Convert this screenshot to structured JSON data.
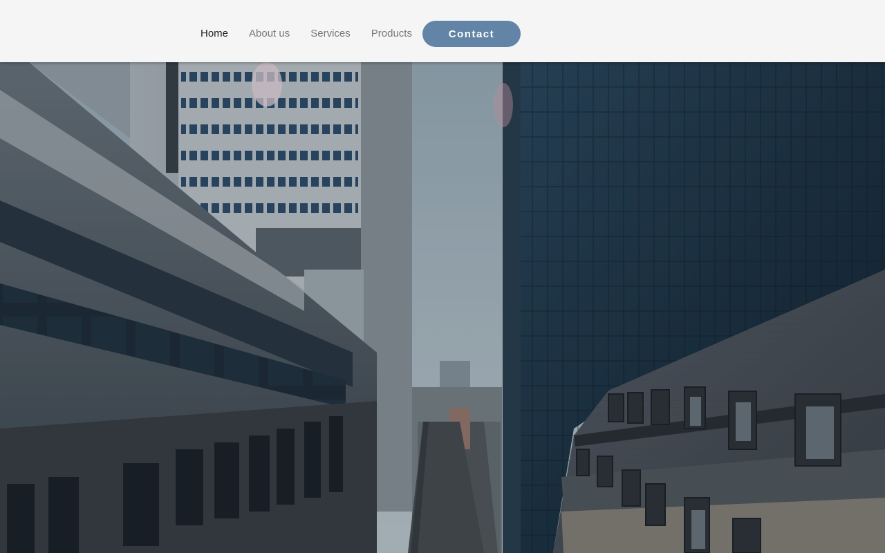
{
  "nav": {
    "items": [
      {
        "label": "Home",
        "active": true
      },
      {
        "label": "About us",
        "active": false
      },
      {
        "label": "Services",
        "active": false
      },
      {
        "label": "Products",
        "active": false
      }
    ],
    "contact_label": "Contact"
  },
  "colors": {
    "header_bg": "#f5f5f5",
    "nav_text": "#777777",
    "nav_active": "#1f1f1f",
    "contact_bg": "#6285a7",
    "sky": "#aebfc8",
    "glass_tower": "#22384a",
    "office_facade": "#5b6670",
    "old_roof": "#4b5158"
  },
  "hero": {
    "icon": "city-skyline-image"
  }
}
